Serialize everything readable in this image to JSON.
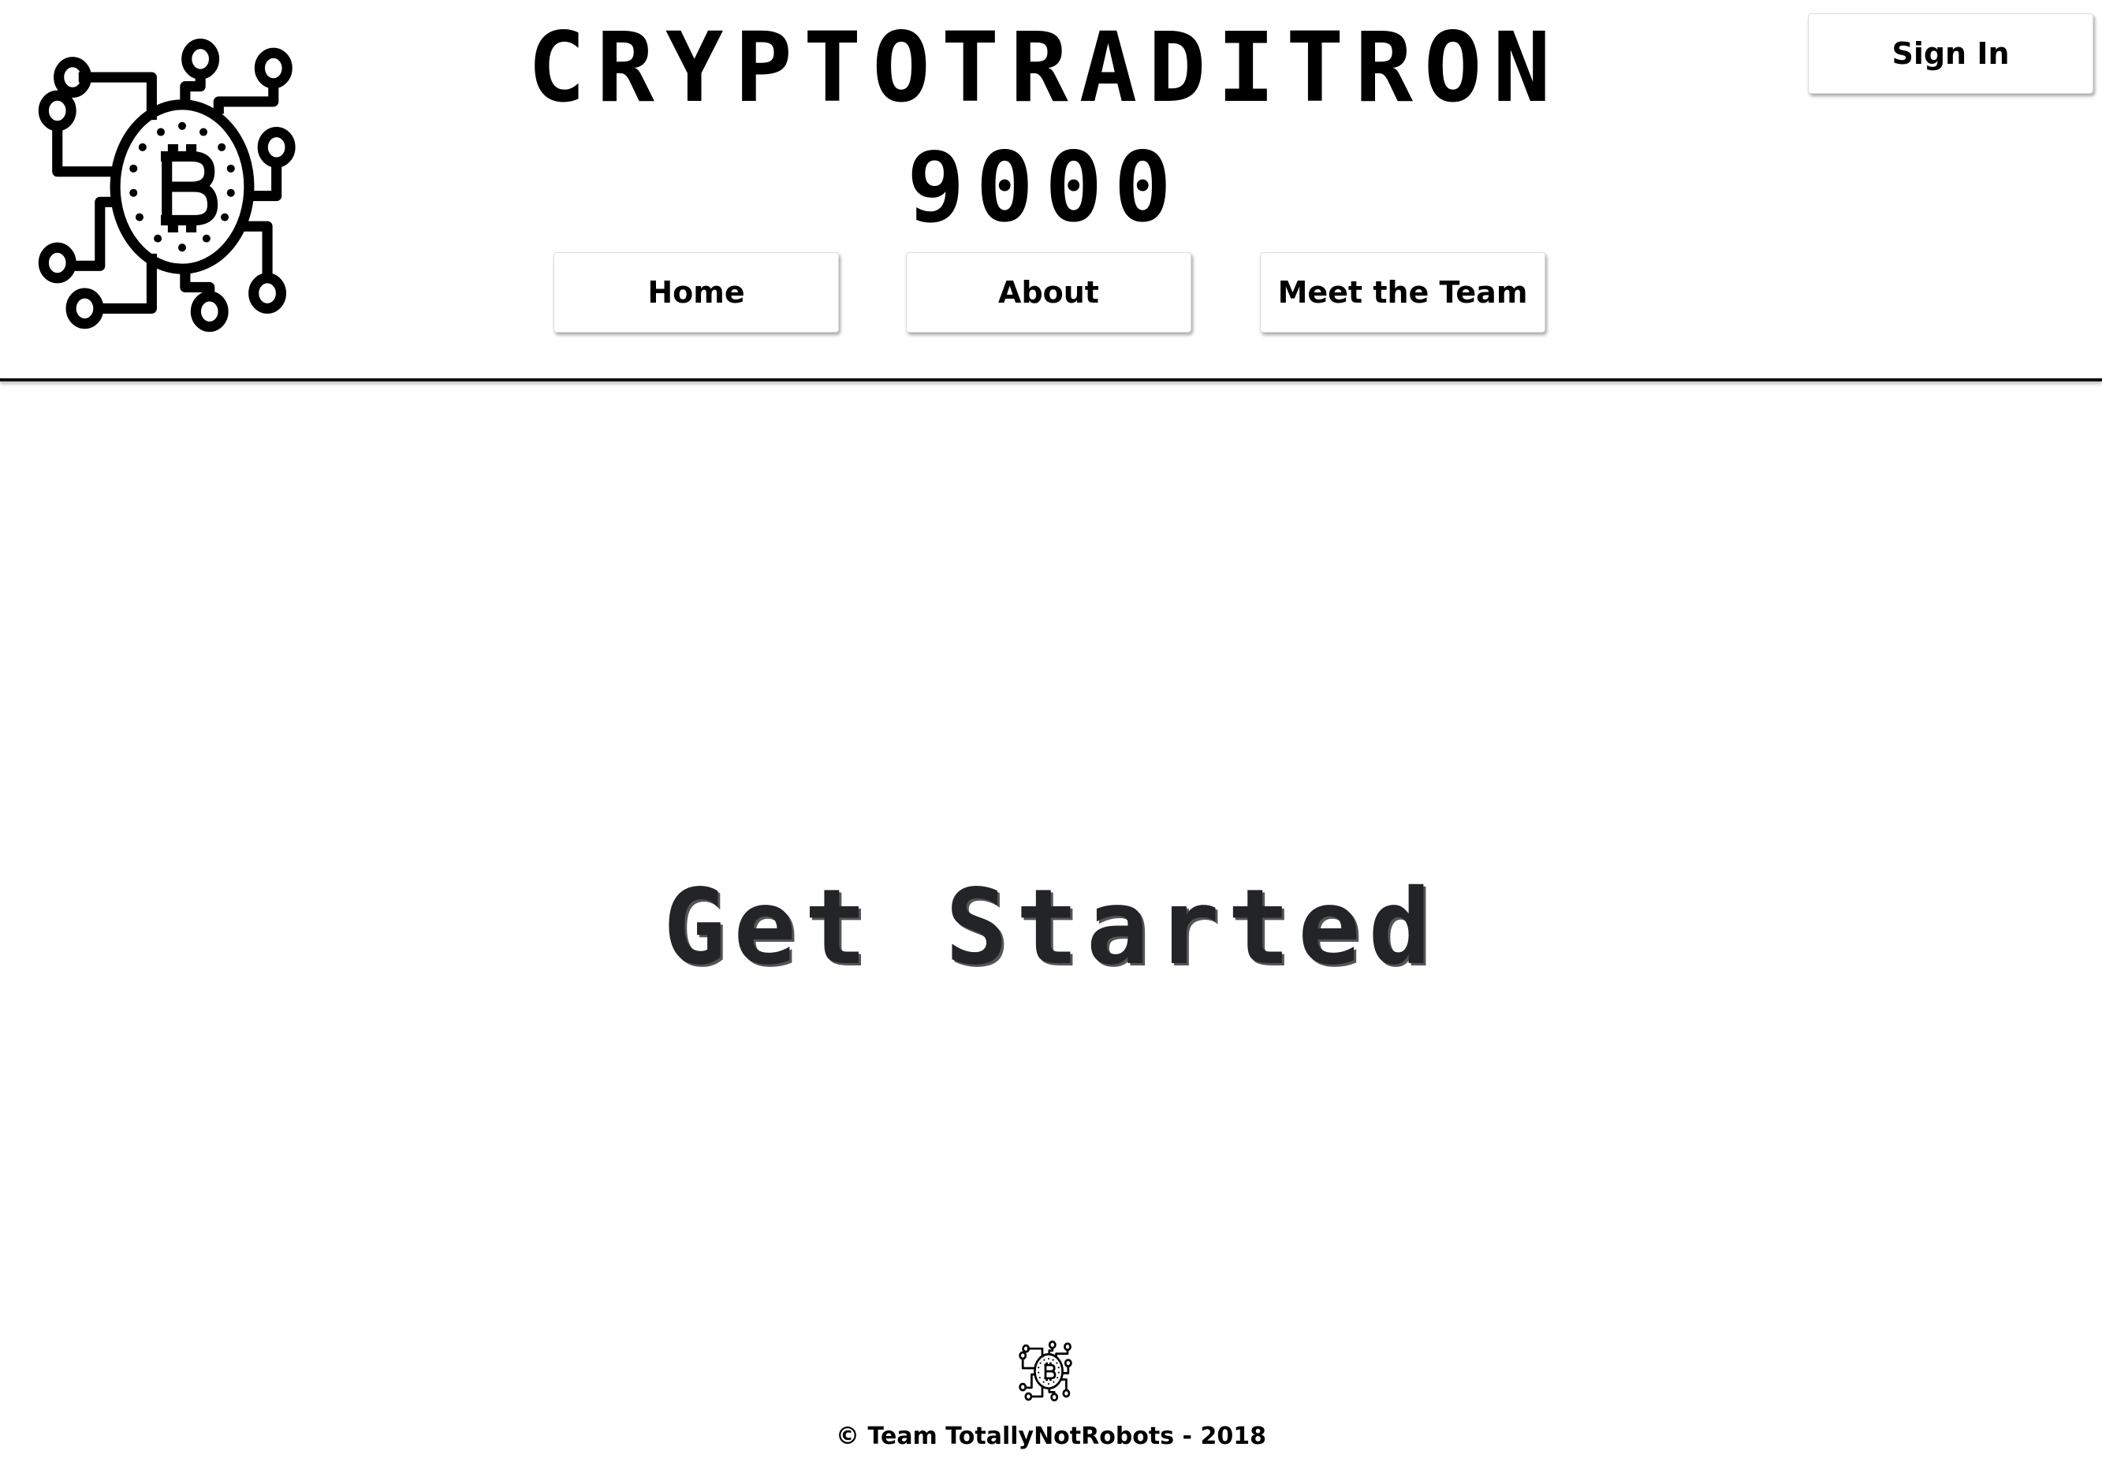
{
  "header": {
    "title_line1": "CRYPTOTRADITRON",
    "title_line2": "9000",
    "logo_icon": "bitcoin-circuit-icon",
    "sign_in_label": "Sign In"
  },
  "nav": {
    "items": [
      {
        "label": "Home"
      },
      {
        "label": "About"
      },
      {
        "label": "Meet the Team"
      }
    ]
  },
  "main": {
    "cta_label": "Get Started"
  },
  "footer": {
    "logo_icon": "bitcoin-circuit-icon",
    "copyright": "© Team TotallyNotRobots - 2018"
  }
}
